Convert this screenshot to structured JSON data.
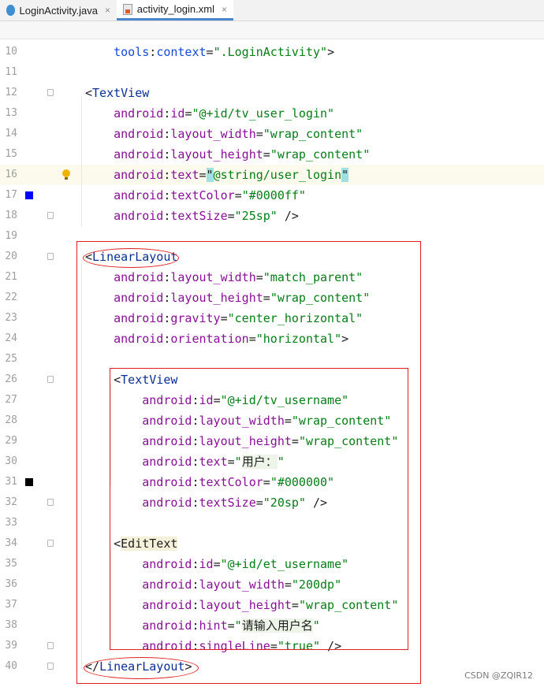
{
  "tabs": [
    {
      "label": "LoginActivity.java",
      "icon": "java-file-icon",
      "active": false
    },
    {
      "label": "activity_login.xml",
      "icon": "xml-file-icon",
      "active": true
    }
  ],
  "close_glyph": "×",
  "lines": [
    {
      "n": "10",
      "t": [
        [
          "attr",
          "    tools"
        ],
        [
          "pun",
          ":"
        ],
        [
          "attr",
          "context"
        ],
        [
          "pun",
          "="
        ],
        [
          "val",
          "\".LoginActivity\""
        ],
        [
          "pun",
          ">"
        ]
      ]
    },
    {
      "n": "11",
      "t": []
    },
    {
      "n": "12",
      "t": [
        [
          "pun",
          "<"
        ],
        [
          "tag",
          "TextView"
        ]
      ]
    },
    {
      "n": "13",
      "t": [
        [
          "nsp",
          "    android"
        ],
        [
          "pun",
          ":"
        ],
        [
          "nsp",
          "id"
        ],
        [
          "pun",
          "="
        ],
        [
          "val",
          "\"@+id/tv_user_login\""
        ]
      ]
    },
    {
      "n": "14",
      "t": [
        [
          "nsp",
          "    android"
        ],
        [
          "pun",
          ":"
        ],
        [
          "nsp",
          "layout_width"
        ],
        [
          "pun",
          "="
        ],
        [
          "val",
          "\"wrap_content\""
        ]
      ]
    },
    {
      "n": "15",
      "t": [
        [
          "nsp",
          "    android"
        ],
        [
          "pun",
          ":"
        ],
        [
          "nsp",
          "layout_height"
        ],
        [
          "pun",
          "="
        ],
        [
          "val",
          "\"wrap_content\""
        ]
      ]
    },
    {
      "n": "16",
      "t": [
        [
          "nsp",
          "    android"
        ],
        [
          "pun",
          ":"
        ],
        [
          "nsp",
          "text"
        ],
        [
          "pun",
          "="
        ],
        [
          "match",
          "\""
        ],
        [
          "val",
          "@string/user_login"
        ],
        [
          "match",
          "\""
        ]
      ]
    },
    {
      "n": "17",
      "t": [
        [
          "nsp",
          "    android"
        ],
        [
          "pun",
          ":"
        ],
        [
          "nsp",
          "textColor"
        ],
        [
          "pun",
          "="
        ],
        [
          "val",
          "\"#0000ff\""
        ]
      ]
    },
    {
      "n": "18",
      "t": [
        [
          "nsp",
          "    android"
        ],
        [
          "pun",
          ":"
        ],
        [
          "nsp",
          "textSize"
        ],
        [
          "pun",
          "="
        ],
        [
          "val",
          "\"25sp\""
        ],
        [
          "pun",
          " />"
        ]
      ]
    },
    {
      "n": "19",
      "t": []
    },
    {
      "n": "20",
      "t": [
        [
          "pun",
          "<"
        ],
        [
          "tag",
          "LinearLayout"
        ]
      ]
    },
    {
      "n": "21",
      "t": [
        [
          "nsp",
          "    android"
        ],
        [
          "pun",
          ":"
        ],
        [
          "nsp",
          "layout_width"
        ],
        [
          "pun",
          "="
        ],
        [
          "val",
          "\"match_parent\""
        ]
      ]
    },
    {
      "n": "22",
      "t": [
        [
          "nsp",
          "    android"
        ],
        [
          "pun",
          ":"
        ],
        [
          "nsp",
          "layout_height"
        ],
        [
          "pun",
          "="
        ],
        [
          "val",
          "\"wrap_content\""
        ]
      ]
    },
    {
      "n": "23",
      "t": [
        [
          "nsp",
          "    android"
        ],
        [
          "pun",
          ":"
        ],
        [
          "nsp",
          "gravity"
        ],
        [
          "pun",
          "="
        ],
        [
          "val",
          "\"center_horizontal\""
        ]
      ]
    },
    {
      "n": "24",
      "t": [
        [
          "nsp",
          "    android"
        ],
        [
          "pun",
          ":"
        ],
        [
          "nsp",
          "orientation"
        ],
        [
          "pun",
          "="
        ],
        [
          "val",
          "\"horizontal\""
        ],
        [
          "pun",
          ">"
        ]
      ]
    },
    {
      "n": "25",
      "t": []
    },
    {
      "n": "26",
      "t": [
        [
          "pun",
          "    <"
        ],
        [
          "tag",
          "TextView"
        ]
      ]
    },
    {
      "n": "27",
      "t": [
        [
          "nsp",
          "        android"
        ],
        [
          "pun",
          ":"
        ],
        [
          "nsp",
          "id"
        ],
        [
          "pun",
          "="
        ],
        [
          "val",
          "\"@+id/tv_username\""
        ]
      ]
    },
    {
      "n": "28",
      "t": [
        [
          "nsp",
          "        android"
        ],
        [
          "pun",
          ":"
        ],
        [
          "nsp",
          "layout_width"
        ],
        [
          "pun",
          "="
        ],
        [
          "val",
          "\"wrap_content\""
        ]
      ]
    },
    {
      "n": "29",
      "t": [
        [
          "nsp",
          "        android"
        ],
        [
          "pun",
          ":"
        ],
        [
          "nsp",
          "layout_height"
        ],
        [
          "pun",
          "="
        ],
        [
          "val",
          "\"wrap_content\""
        ]
      ]
    },
    {
      "n": "30",
      "t": [
        [
          "nsp",
          "        android"
        ],
        [
          "pun",
          ":"
        ],
        [
          "nsp",
          "text"
        ],
        [
          "pun",
          "="
        ],
        [
          "val",
          "\""
        ],
        [
          "chinese",
          "用户："
        ],
        [
          "val",
          "\""
        ]
      ]
    },
    {
      "n": "31",
      "t": [
        [
          "nsp",
          "        android"
        ],
        [
          "pun",
          ":"
        ],
        [
          "nsp",
          "textColor"
        ],
        [
          "pun",
          "="
        ],
        [
          "val",
          "\"#000000\""
        ]
      ]
    },
    {
      "n": "32",
      "t": [
        [
          "nsp",
          "        android"
        ],
        [
          "pun",
          ":"
        ],
        [
          "nsp",
          "textSize"
        ],
        [
          "pun",
          "="
        ],
        [
          "val",
          "\"20sp\""
        ],
        [
          "pun",
          " />"
        ]
      ]
    },
    {
      "n": "33",
      "t": []
    },
    {
      "n": "34",
      "t": [
        [
          "pun",
          "    <"
        ],
        [
          "tagbg",
          "EditText"
        ]
      ]
    },
    {
      "n": "35",
      "t": [
        [
          "nsp",
          "        android"
        ],
        [
          "pun",
          ":"
        ],
        [
          "nsp",
          "id"
        ],
        [
          "pun",
          "="
        ],
        [
          "val",
          "\"@+id/et_username\""
        ]
      ]
    },
    {
      "n": "36",
      "t": [
        [
          "nsp",
          "        android"
        ],
        [
          "pun",
          ":"
        ],
        [
          "nsp",
          "layout_width"
        ],
        [
          "pun",
          "="
        ],
        [
          "val",
          "\"200dp\""
        ]
      ]
    },
    {
      "n": "37",
      "t": [
        [
          "nsp",
          "        android"
        ],
        [
          "pun",
          ":"
        ],
        [
          "nsp",
          "layout_height"
        ],
        [
          "pun",
          "="
        ],
        [
          "val",
          "\"wrap_content\""
        ]
      ]
    },
    {
      "n": "38",
      "t": [
        [
          "nsp",
          "        android"
        ],
        [
          "pun",
          ":"
        ],
        [
          "nsp",
          "hint"
        ],
        [
          "pun",
          "="
        ],
        [
          "val",
          "\""
        ],
        [
          "chinese",
          "请输入用户名"
        ],
        [
          "val",
          "\""
        ]
      ]
    },
    {
      "n": "39",
      "t": [
        [
          "nsp",
          "        android"
        ],
        [
          "pun",
          ":"
        ],
        [
          "nsp",
          "singleLine"
        ],
        [
          "pun",
          "="
        ],
        [
          "val",
          "\"true\""
        ],
        [
          "pun",
          " />"
        ]
      ]
    },
    {
      "n": "40",
      "t": [
        [
          "pun",
          "</"
        ],
        [
          "tag",
          "LinearLayout"
        ],
        [
          "pun",
          ">"
        ]
      ]
    }
  ],
  "highlight_line": "16",
  "swatch_colors": {
    "17": "#0000ff",
    "31": "#000000"
  },
  "watermark": "CSDN @ZQIR12"
}
